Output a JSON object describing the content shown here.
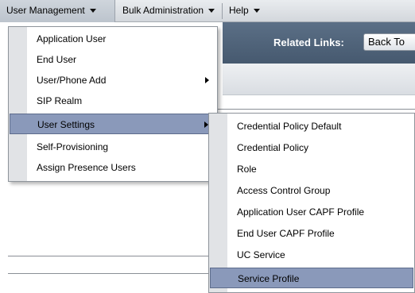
{
  "menubar": {
    "items": [
      {
        "label": "User Management"
      },
      {
        "label": "Bulk Administration"
      },
      {
        "label": "Help"
      }
    ]
  },
  "header": {
    "related_links_label": "Related Links:",
    "back_button_label": "Back To"
  },
  "user_management_menu": {
    "items": [
      {
        "label": "Application User"
      },
      {
        "label": "End User"
      },
      {
        "label": "User/Phone Add"
      },
      {
        "label": "SIP Realm"
      },
      {
        "label": "User Settings"
      },
      {
        "label": "Self-Provisioning"
      },
      {
        "label": "Assign Presence Users"
      }
    ],
    "selected": "User Settings"
  },
  "user_settings_submenu": {
    "items": [
      {
        "label": "Credential Policy Default"
      },
      {
        "label": "Credential Policy"
      },
      {
        "label": "Role"
      },
      {
        "label": "Access Control Group"
      },
      {
        "label": "Application User CAPF Profile"
      },
      {
        "label": "End User CAPF Profile"
      },
      {
        "label": "UC Service"
      },
      {
        "label": "Service Profile"
      }
    ],
    "selected": "Service Profile"
  },
  "colors": {
    "highlight": "#8a99ba",
    "banner": "#4f637a",
    "menubar": "#dde1e5"
  }
}
